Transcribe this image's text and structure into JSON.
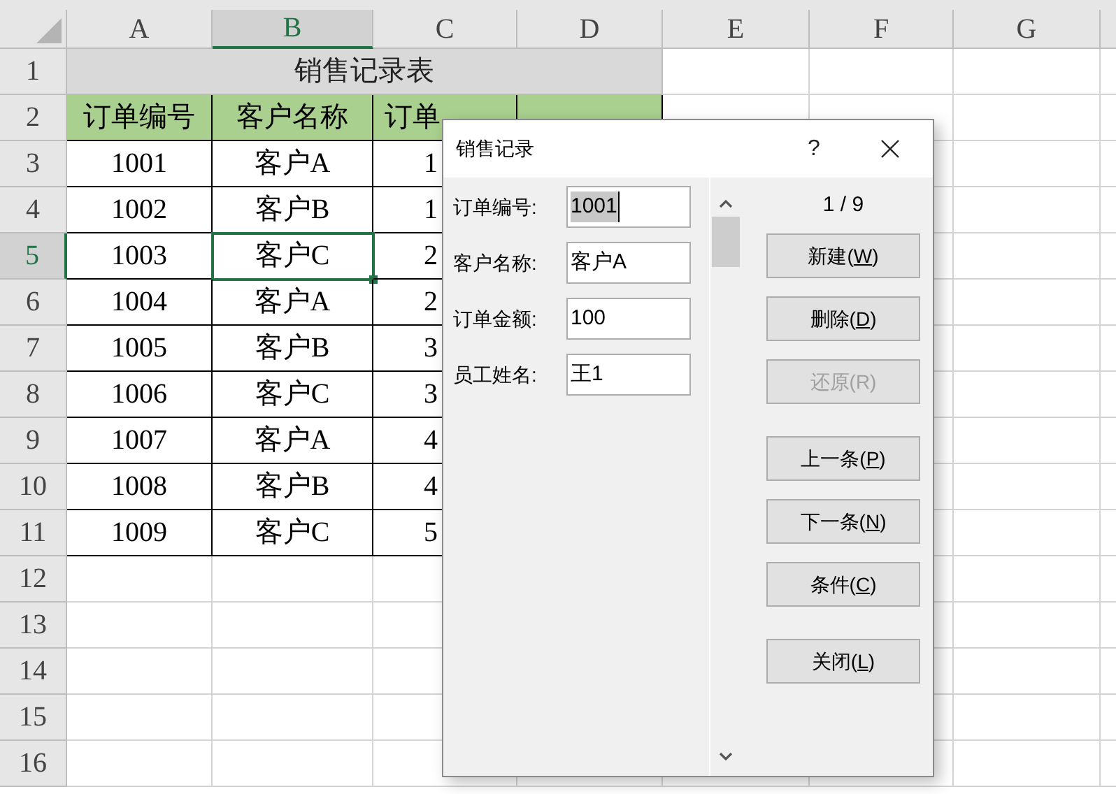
{
  "sheet": {
    "columns": [
      {
        "label": "A",
        "selected": false
      },
      {
        "label": "B",
        "selected": true
      },
      {
        "label": "C",
        "selected": false
      },
      {
        "label": "D",
        "selected": false
      },
      {
        "label": "E",
        "selected": false
      },
      {
        "label": "F",
        "selected": false
      },
      {
        "label": "G",
        "selected": false
      }
    ],
    "rows": [
      {
        "label": "1",
        "selected": false
      },
      {
        "label": "2",
        "selected": false
      },
      {
        "label": "3",
        "selected": false
      },
      {
        "label": "4",
        "selected": false
      },
      {
        "label": "5",
        "selected": true
      },
      {
        "label": "6",
        "selected": false
      },
      {
        "label": "7",
        "selected": false
      },
      {
        "label": "8",
        "selected": false
      },
      {
        "label": "9",
        "selected": false
      },
      {
        "label": "10",
        "selected": false
      },
      {
        "label": "11",
        "selected": false
      },
      {
        "label": "12",
        "selected": false
      },
      {
        "label": "13",
        "selected": false
      },
      {
        "label": "14",
        "selected": false
      },
      {
        "label": "15",
        "selected": false
      },
      {
        "label": "16",
        "selected": false
      }
    ],
    "title": "销售记录表",
    "headers": [
      "订单编号",
      "客户名称",
      "订单"
    ],
    "records": [
      {
        "cells": [
          {
            "text": "1001",
            "selected": false
          },
          {
            "text": "客户A",
            "selected": false
          },
          {
            "text": "1",
            "selected": false
          }
        ]
      },
      {
        "cells": [
          {
            "text": "1002",
            "selected": false
          },
          {
            "text": "客户B",
            "selected": false
          },
          {
            "text": "1",
            "selected": false
          }
        ]
      },
      {
        "cells": [
          {
            "text": "1003",
            "selected": false
          },
          {
            "text": "客户C",
            "selected": true
          },
          {
            "text": "2",
            "selected": false
          }
        ]
      },
      {
        "cells": [
          {
            "text": "1004",
            "selected": false
          },
          {
            "text": "客户A",
            "selected": false
          },
          {
            "text": "2",
            "selected": false
          }
        ]
      },
      {
        "cells": [
          {
            "text": "1005",
            "selected": false
          },
          {
            "text": "客户B",
            "selected": false
          },
          {
            "text": "3",
            "selected": false
          }
        ]
      },
      {
        "cells": [
          {
            "text": "1006",
            "selected": false
          },
          {
            "text": "客户C",
            "selected": false
          },
          {
            "text": "3",
            "selected": false
          }
        ]
      },
      {
        "cells": [
          {
            "text": "1007",
            "selected": false
          },
          {
            "text": "客户A",
            "selected": false
          },
          {
            "text": "4",
            "selected": false
          }
        ]
      },
      {
        "cells": [
          {
            "text": "1008",
            "selected": false
          },
          {
            "text": "客户B",
            "selected": false
          },
          {
            "text": "4",
            "selected": false
          }
        ]
      },
      {
        "cells": [
          {
            "text": "1009",
            "selected": false
          },
          {
            "text": "客户C",
            "selected": false
          },
          {
            "text": "5",
            "selected": false
          }
        ]
      }
    ]
  },
  "dialog": {
    "title": "销售记录",
    "help": "?",
    "fields": [
      {
        "label": "订单编号:",
        "value": "1001",
        "text_selected": true
      },
      {
        "label": "客户名称:",
        "value": "客户A",
        "text_selected": false
      },
      {
        "label": "订单金额:",
        "value": "100",
        "text_selected": false
      },
      {
        "label": "员工姓名:",
        "value": "王1",
        "text_selected": false
      }
    ],
    "counter": "1 / 9",
    "button_groups": [
      [
        {
          "before": "新建(",
          "mnemonic": "W",
          "after": ")",
          "disabled": false
        },
        {
          "before": "删除(",
          "mnemonic": "D",
          "after": ")",
          "disabled": false
        },
        {
          "before": "还原(R)",
          "disabled": true
        }
      ],
      [
        {
          "before": "上一条(",
          "mnemonic": "P",
          "after": ")",
          "disabled": false
        },
        {
          "before": "下一条(",
          "mnemonic": "N",
          "after": ")",
          "disabled": false
        },
        {
          "before": "条件(",
          "mnemonic": "C",
          "after": ")",
          "disabled": false
        }
      ],
      [
        {
          "before": "关闭(",
          "mnemonic": "L",
          "after": ")",
          "disabled": false
        }
      ]
    ]
  }
}
